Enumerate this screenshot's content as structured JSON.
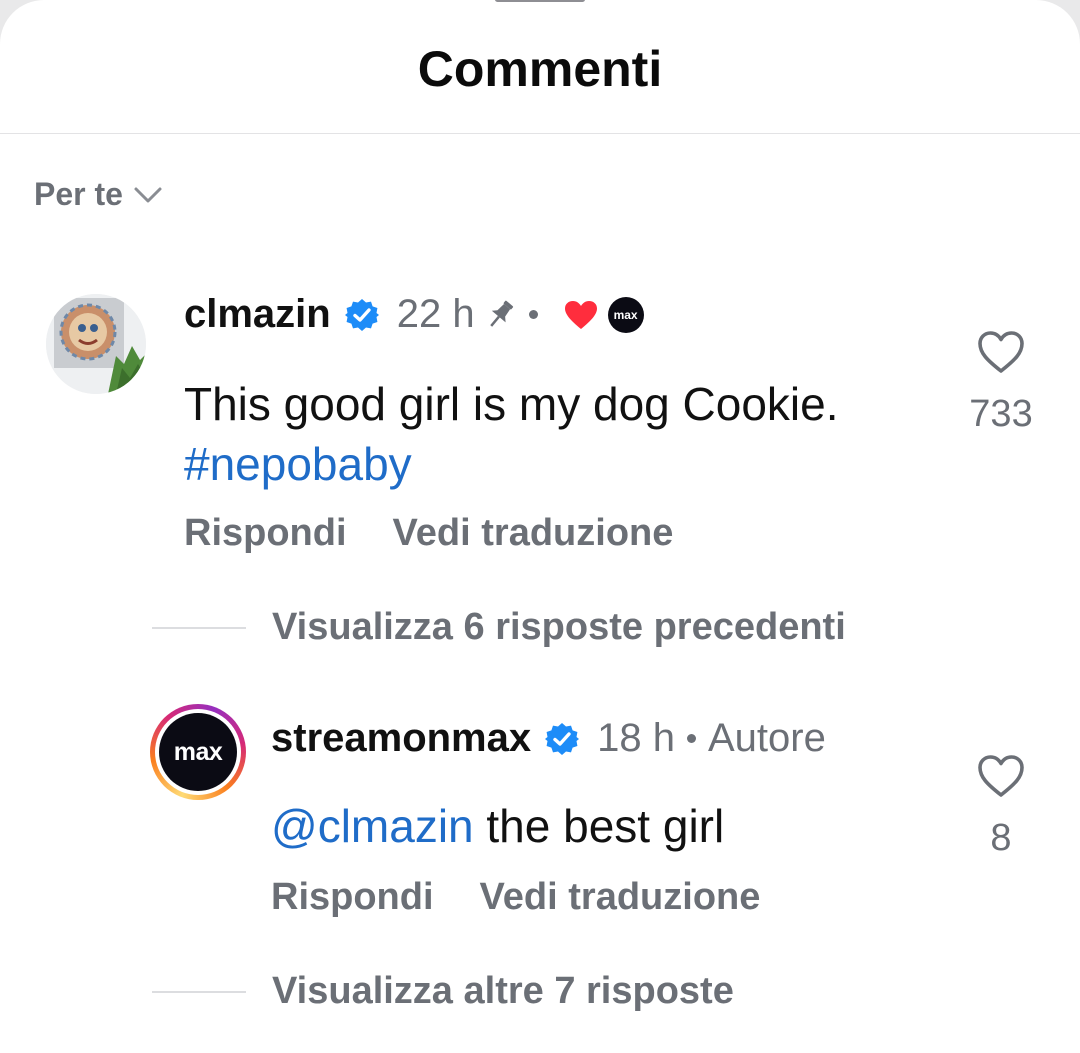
{
  "header": {
    "title": "Commenti"
  },
  "sort": {
    "label": "Per te",
    "icon": "chevron-down-icon"
  },
  "comments": [
    {
      "username": "clmazin",
      "verified": true,
      "time": "22 h",
      "pinned": true,
      "liked_by_creator": true,
      "creator_badge": "max",
      "text": "This good girl is my dog Cookie.",
      "hashtag": "#nepobaby",
      "reply_label": "Rispondi",
      "translate_label": "Vedi traduzione",
      "likes": "733",
      "view_replies": "Visualizza 6 risposte precedenti"
    },
    {
      "username": "streamonmax",
      "verified": true,
      "time": "18 h",
      "author_label": "Autore",
      "avatar_text": "max",
      "mention": "@clmazin",
      "text": " the best girl",
      "reply_label": "Rispondi",
      "translate_label": "Vedi traduzione",
      "likes": "8",
      "view_replies": "Visualizza altre 7 risposte"
    }
  ],
  "colors": {
    "link": "#1f6cc8",
    "verified": "#1d8cf8",
    "heart": "#ff2d3d",
    "muted": "#6b6f76"
  }
}
